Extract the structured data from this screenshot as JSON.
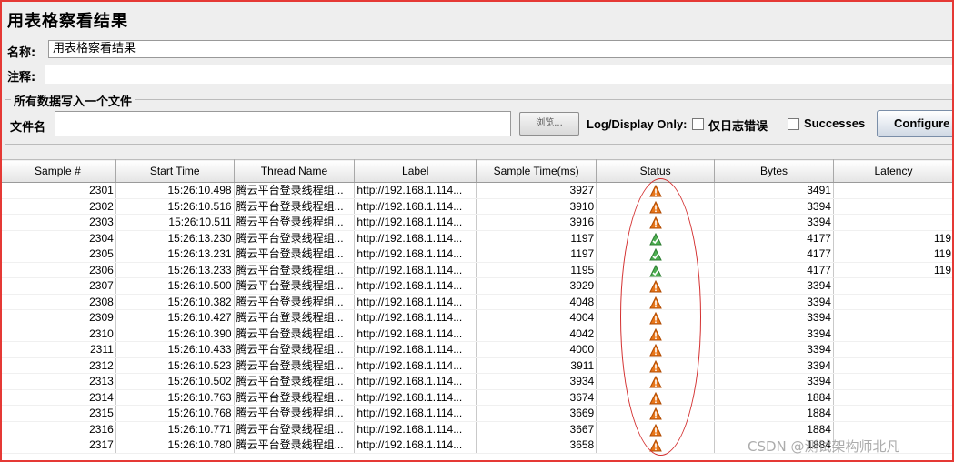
{
  "panel": {
    "title": "用表格察看结果",
    "name_label": "名称:",
    "name_value": "用表格察看结果",
    "comment_label": "注释:",
    "comment_value": ""
  },
  "file_section": {
    "title": "所有数据写入一个文件",
    "filename_label": "文件名",
    "filename_value": "",
    "browse_label": "浏览...",
    "log_display_label": "Log/Display Only:",
    "errors_only_label": "仅日志错误",
    "errors_only_checked": false,
    "successes_label": "Successes",
    "successes_checked": false,
    "configure_label": "Configure"
  },
  "table": {
    "columns": [
      "Sample #",
      "Start Time",
      "Thread Name",
      "Label",
      "Sample Time(ms)",
      "Status",
      "Bytes",
      "Latency"
    ],
    "rows": [
      {
        "sample": "2301",
        "start": "15:26:10.498",
        "thread": "腾云平台登录线程组...",
        "label": "http://192.168.1.114...",
        "time": "3927",
        "status": "warning",
        "bytes": "3491",
        "latency": ""
      },
      {
        "sample": "2302",
        "start": "15:26:10.516",
        "thread": "腾云平台登录线程组...",
        "label": "http://192.168.1.114...",
        "time": "3910",
        "status": "warning",
        "bytes": "3394",
        "latency": ""
      },
      {
        "sample": "2303",
        "start": "15:26:10.511",
        "thread": "腾云平台登录线程组...",
        "label": "http://192.168.1.114...",
        "time": "3916",
        "status": "warning",
        "bytes": "3394",
        "latency": ""
      },
      {
        "sample": "2304",
        "start": "15:26:13.230",
        "thread": "腾云平台登录线程组...",
        "label": "http://192.168.1.114...",
        "time": "1197",
        "status": "success",
        "bytes": "4177",
        "latency": "119"
      },
      {
        "sample": "2305",
        "start": "15:26:13.231",
        "thread": "腾云平台登录线程组...",
        "label": "http://192.168.1.114...",
        "time": "1197",
        "status": "success",
        "bytes": "4177",
        "latency": "119"
      },
      {
        "sample": "2306",
        "start": "15:26:13.233",
        "thread": "腾云平台登录线程组...",
        "label": "http://192.168.1.114...",
        "time": "1195",
        "status": "success",
        "bytes": "4177",
        "latency": "119"
      },
      {
        "sample": "2307",
        "start": "15:26:10.500",
        "thread": "腾云平台登录线程组...",
        "label": "http://192.168.1.114...",
        "time": "3929",
        "status": "warning",
        "bytes": "3394",
        "latency": ""
      },
      {
        "sample": "2308",
        "start": "15:26:10.382",
        "thread": "腾云平台登录线程组...",
        "label": "http://192.168.1.114...",
        "time": "4048",
        "status": "warning",
        "bytes": "3394",
        "latency": ""
      },
      {
        "sample": "2309",
        "start": "15:26:10.427",
        "thread": "腾云平台登录线程组...",
        "label": "http://192.168.1.114...",
        "time": "4004",
        "status": "warning",
        "bytes": "3394",
        "latency": ""
      },
      {
        "sample": "2310",
        "start": "15:26:10.390",
        "thread": "腾云平台登录线程组...",
        "label": "http://192.168.1.114...",
        "time": "4042",
        "status": "warning",
        "bytes": "3394",
        "latency": ""
      },
      {
        "sample": "2311",
        "start": "15:26:10.433",
        "thread": "腾云平台登录线程组...",
        "label": "http://192.168.1.114...",
        "time": "4000",
        "status": "warning",
        "bytes": "3394",
        "latency": ""
      },
      {
        "sample": "2312",
        "start": "15:26:10.523",
        "thread": "腾云平台登录线程组...",
        "label": "http://192.168.1.114...",
        "time": "3911",
        "status": "warning",
        "bytes": "3394",
        "latency": ""
      },
      {
        "sample": "2313",
        "start": "15:26:10.502",
        "thread": "腾云平台登录线程组...",
        "label": "http://192.168.1.114...",
        "time": "3934",
        "status": "warning",
        "bytes": "3394",
        "latency": ""
      },
      {
        "sample": "2314",
        "start": "15:26:10.763",
        "thread": "腾云平台登录线程组...",
        "label": "http://192.168.1.114...",
        "time": "3674",
        "status": "warning",
        "bytes": "1884",
        "latency": ""
      },
      {
        "sample": "2315",
        "start": "15:26:10.768",
        "thread": "腾云平台登录线程组...",
        "label": "http://192.168.1.114...",
        "time": "3669",
        "status": "warning",
        "bytes": "1884",
        "latency": ""
      },
      {
        "sample": "2316",
        "start": "15:26:10.771",
        "thread": "腾云平台登录线程组...",
        "label": "http://192.168.1.114...",
        "time": "3667",
        "status": "warning",
        "bytes": "1884",
        "latency": ""
      },
      {
        "sample": "2317",
        "start": "15:26:10.780",
        "thread": "腾云平台登录线程组...",
        "label": "http://192.168.1.114...",
        "time": "3658",
        "status": "warning",
        "bytes": "1884",
        "latency": ""
      }
    ]
  },
  "icons": {
    "warning": "warning-icon",
    "success": "success-icon"
  },
  "colors": {
    "highlight_border": "#e53935",
    "warning_fill": "#e8761a",
    "success_fill": "#4caf50"
  },
  "watermark": "CSDN @测试架构师北凡"
}
